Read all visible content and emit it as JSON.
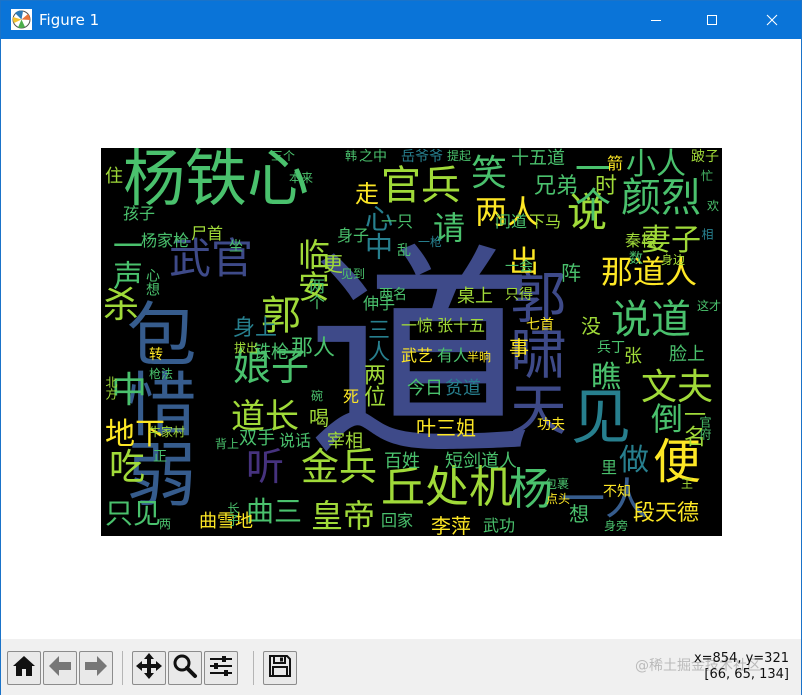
{
  "window": {
    "title": "Figure 1",
    "minimize_icon": "minimize-icon",
    "maximize_icon": "maximize-icon",
    "close_icon": "close-icon"
  },
  "toolbar": {
    "buttons": [
      "home-icon",
      "back-arrow-icon",
      "forward-arrow-icon",
      "pan-icon",
      "zoom-icon",
      "configure-subplots-icon",
      "save-icon"
    ],
    "coords_line1": "x=854, y=321",
    "coords_line2": "[66, 65, 134]",
    "watermark": "@稀土掘金技术社区"
  },
  "colors": {
    "titlebar": "#0a74d8",
    "cloud_background": "#000000",
    "palette": [
      "#3e4a89",
      "#46327e",
      "#365c8d",
      "#277f8e",
      "#1fa187",
      "#4ac16d",
      "#a0da39",
      "#fde725",
      "#440154"
    ]
  },
  "wordcloud": {
    "words": [
      {
        "t": "道",
        "c": "#3e4a89"
      },
      {
        "t": "杨铁心",
        "c": "#4ac16d"
      },
      {
        "t": "包惜弱",
        "c": "#365c8d"
      },
      {
        "t": "郭啸天",
        "c": "#3e4a89"
      },
      {
        "t": "丘处机",
        "c": "#a0da39"
      },
      {
        "t": "说道",
        "c": "#4ac16d"
      },
      {
        "t": "官兵",
        "c": "#a0da39"
      },
      {
        "t": "武官",
        "c": "#3e4a89"
      },
      {
        "t": "颜烈",
        "c": "#4ac16d"
      },
      {
        "t": "见",
        "c": "#277f8e"
      },
      {
        "t": "说",
        "c": "#a0da39"
      },
      {
        "t": "郭",
        "c": "#a0da39"
      },
      {
        "t": "临安",
        "c": "#a0da39"
      },
      {
        "t": "娘子",
        "c": "#4ac16d"
      },
      {
        "t": "金兵",
        "c": "#a0da39"
      },
      {
        "t": "道长",
        "c": "#a0da39"
      },
      {
        "t": "文夫",
        "c": "#a0da39"
      },
      {
        "t": "那道人",
        "c": "#fde725"
      },
      {
        "t": "杨",
        "c": "#4ac16d"
      },
      {
        "t": "一人",
        "c": "#365c8d"
      },
      {
        "t": "两人",
        "c": "#fde725"
      },
      {
        "t": "便",
        "c": "#fde725"
      },
      {
        "t": "笑",
        "c": "#4ac16d"
      },
      {
        "t": "请",
        "c": "#4ac16d"
      },
      {
        "t": "皇帝",
        "c": "#a0da39"
      },
      {
        "t": "曲三",
        "c": "#4ac16d"
      },
      {
        "t": "听",
        "c": "#46327e"
      },
      {
        "t": "倒",
        "c": "#4ac16d"
      },
      {
        "t": "做",
        "c": "#277f8e"
      },
      {
        "t": "瞧",
        "c": "#4ac16d"
      },
      {
        "t": "中",
        "c": "#4ac16d"
      },
      {
        "t": "地下",
        "c": "#fde725"
      },
      {
        "t": "吃",
        "c": "#a0da39"
      },
      {
        "t": "只见",
        "c": "#4ac16d"
      },
      {
        "t": "一声",
        "c": "#4ac16d"
      },
      {
        "t": "杀",
        "c": "#a0da39"
      },
      {
        "t": "小人",
        "c": "#4ac16d"
      },
      {
        "t": "妻子",
        "c": "#a0da39"
      },
      {
        "t": "段天德",
        "c": "#fde725"
      },
      {
        "t": "一名",
        "c": "#a0da39"
      },
      {
        "t": "出",
        "c": "#fde725"
      },
      {
        "t": "一个",
        "c": "#4ac16d"
      },
      {
        "t": "走",
        "c": "#fde725"
      },
      {
        "t": "兄弟",
        "c": "#4ac16d"
      },
      {
        "t": "时",
        "c": "#a0da39"
      },
      {
        "t": "心中",
        "c": "#277f8e"
      },
      {
        "t": "身上",
        "c": "#277f8e"
      },
      {
        "t": "铁枪",
        "c": "#4ac16d"
      },
      {
        "t": "那人",
        "c": "#4ac16d"
      },
      {
        "t": "两位",
        "c": "#a0da39"
      },
      {
        "t": "三人",
        "c": "#277f8e"
      },
      {
        "t": "叶三姐",
        "c": "#fde725"
      },
      {
        "t": "百姓",
        "c": "#4ac16d"
      },
      {
        "t": "短剑",
        "c": "#4ac16d"
      },
      {
        "t": "道人",
        "c": "#4ac16d"
      },
      {
        "t": "回家",
        "c": "#4ac16d"
      },
      {
        "t": "李萍",
        "c": "#fde725"
      },
      {
        "t": "武功",
        "c": "#4ac16d"
      },
      {
        "t": "曲雪地",
        "c": "#fde725"
      },
      {
        "t": "双手",
        "c": "#4ac16d"
      },
      {
        "t": "说话",
        "c": "#4ac16d"
      },
      {
        "t": "喝",
        "c": "#a0da39"
      },
      {
        "t": "宰相",
        "c": "#a0da39"
      },
      {
        "t": "今日",
        "c": "#4ac16d"
      },
      {
        "t": "贫道",
        "c": "#277f8e"
      },
      {
        "t": "武艺",
        "c": "#fde725"
      },
      {
        "t": "有人",
        "c": "#4ac16d"
      },
      {
        "t": "一惊",
        "c": "#a0da39"
      },
      {
        "t": "张十五",
        "c": "#a0da39"
      },
      {
        "t": "两名",
        "c": "#4ac16d"
      },
      {
        "t": "桌上",
        "c": "#a0da39"
      },
      {
        "t": "只得",
        "c": "#a0da39"
      },
      {
        "t": "伸手",
        "c": "#4ac16d"
      },
      {
        "t": "问道",
        "c": "#4ac16d"
      },
      {
        "t": "下马",
        "c": "#a0da39"
      },
      {
        "t": "一只",
        "c": "#4ac16d"
      },
      {
        "t": "十五道",
        "c": "#4ac16d"
      },
      {
        "t": "身子",
        "c": "#4ac16d"
      },
      {
        "t": "更",
        "c": "#a0da39"
      },
      {
        "t": "两个",
        "c": "#4ac16d"
      },
      {
        "t": "杨家枪",
        "c": "#4ac16d"
      },
      {
        "t": "尸首",
        "c": "#a0da39"
      },
      {
        "t": "孩子",
        "c": "#4ac16d"
      },
      {
        "t": "住",
        "c": "#a0da39"
      },
      {
        "t": "事",
        "c": "#fde725"
      },
      {
        "t": "脸上",
        "c": "#4ac16d"
      },
      {
        "t": "秦桧",
        "c": "#a0da39"
      },
      {
        "t": "箭",
        "c": "#fde725"
      },
      {
        "t": "阵",
        "c": "#4ac16d"
      },
      {
        "t": "没",
        "c": "#a0da39"
      },
      {
        "t": "张",
        "c": "#a0da39"
      },
      {
        "t": "岳爷爷",
        "c": "#277f8e"
      },
      {
        "t": "之中",
        "c": "#4ac16d"
      },
      {
        "t": "三个",
        "c": "#4ac16d"
      },
      {
        "t": "本来",
        "c": "#4ac16d"
      },
      {
        "t": "牛家村",
        "c": "#a0da39"
      },
      {
        "t": "拔出",
        "c": "#a0da39"
      },
      {
        "t": "里",
        "c": "#4ac16d"
      },
      {
        "t": "不知",
        "c": "#fde725"
      },
      {
        "t": "身旁",
        "c": "#4ac16d"
      },
      {
        "t": "一会",
        "c": "#4ac16d"
      },
      {
        "t": "见到",
        "c": "#4ac16d"
      },
      {
        "t": "七首",
        "c": "#fde725"
      },
      {
        "t": "兵丁",
        "c": "#4ac16d"
      },
      {
        "t": "跛子",
        "c": "#a0da39"
      },
      {
        "t": "提起",
        "c": "#4ac16d"
      },
      {
        "t": "韩",
        "c": "#4ac16d"
      },
      {
        "t": "乱",
        "c": "#4ac16d"
      },
      {
        "t": "一枪",
        "c": "#277f8e"
      },
      {
        "t": "功夫",
        "c": "#fde725"
      },
      {
        "t": "半晌",
        "c": "#fde725"
      },
      {
        "t": "包裹",
        "c": "#4ac16d"
      },
      {
        "t": "点头",
        "c": "#fde725"
      },
      {
        "t": "这才",
        "c": "#4ac16d"
      },
      {
        "t": "背上",
        "c": "#4ac16d"
      },
      {
        "t": "枪法",
        "c": "#4ac16d"
      },
      {
        "t": "北方",
        "c": "#a0da39"
      },
      {
        "t": "转",
        "c": "#fde725"
      },
      {
        "t": "死",
        "c": "#fde725"
      },
      {
        "t": "想",
        "c": "#4ac16d"
      },
      {
        "t": "长子",
        "c": "#4ac16d"
      },
      {
        "t": "两",
        "c": "#4ac16d"
      },
      {
        "t": "官府",
        "c": "#4ac16d"
      },
      {
        "t": "身边",
        "c": "#a0da39"
      },
      {
        "t": "数",
        "c": "#4ac16d"
      },
      {
        "t": "坐",
        "c": "#4ac16d"
      },
      {
        "t": "心想",
        "c": "#4ac16d"
      },
      {
        "t": "欢",
        "c": "#4ac16d"
      },
      {
        "t": "相",
        "c": "#277f8e"
      },
      {
        "t": "碗",
        "c": "#4ac16d"
      },
      {
        "t": "正",
        "c": "#4ac16d"
      },
      {
        "t": "王",
        "c": "#a0da39"
      },
      {
        "t": "忙",
        "c": "#4ac16d"
      }
    ]
  }
}
